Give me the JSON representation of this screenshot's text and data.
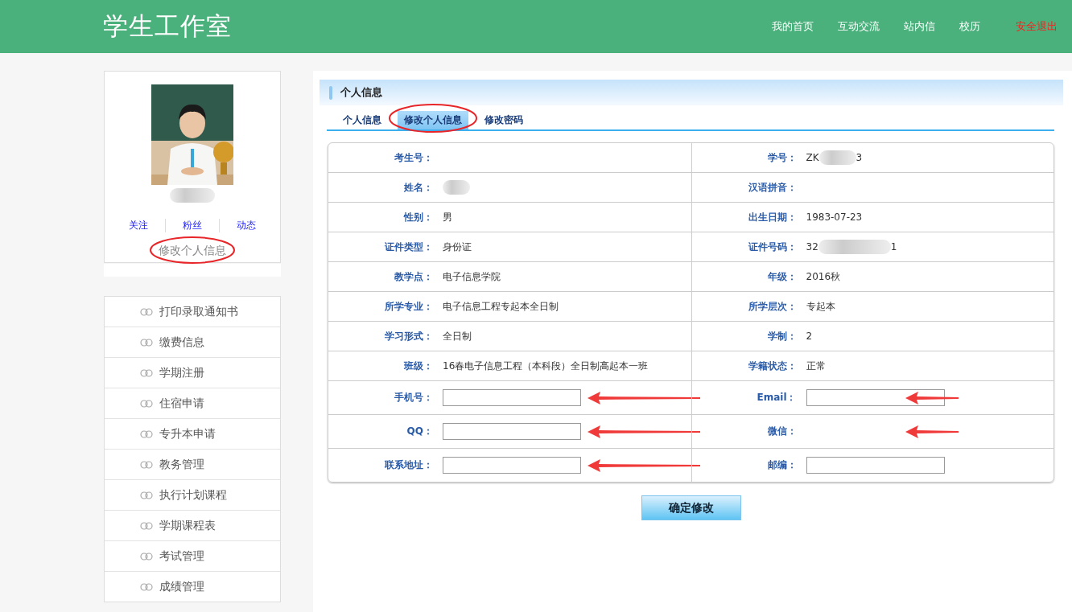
{
  "header": {
    "title": "学生工作室",
    "nav": [
      {
        "label": "我的首页",
        "kind": "link"
      },
      {
        "label": "互动交流",
        "kind": "link"
      },
      {
        "label": "站内信",
        "kind": "link"
      },
      {
        "label": "校历",
        "kind": "link"
      },
      {
        "label": "安全退出",
        "kind": "logout"
      }
    ]
  },
  "profile": {
    "name_redacted": true,
    "links": [
      "关注",
      "粉丝",
      "动态"
    ],
    "edit_link": {
      "label": "修改个人信息",
      "circled": true
    }
  },
  "menu": [
    "打印录取通知书",
    "缴费信息",
    "学期注册",
    "住宿申请",
    "专升本申请",
    "教务管理",
    "执行计划课程",
    "学期课程表",
    "考试管理",
    "成绩管理"
  ],
  "panel": {
    "title": "个人信息",
    "tabs": [
      {
        "label": "个人信息",
        "selected": false,
        "circled": false
      },
      {
        "label": "修改个人信息",
        "selected": true,
        "circled": true
      },
      {
        "label": "修改密码",
        "selected": false,
        "circled": false
      }
    ]
  },
  "form": {
    "rows": [
      [
        {
          "label": "考生号："
        },
        {
          "label": "学号：",
          "value": "ZK",
          "value_end": "3",
          "redacted": true
        }
      ],
      [
        {
          "label": "姓名：",
          "redacted": true
        },
        {
          "label": "汉语拼音："
        }
      ],
      [
        {
          "label": "性别：",
          "value": "男"
        },
        {
          "label": "出生日期：",
          "value": "1983-07-23"
        }
      ],
      [
        {
          "label": "证件类型：",
          "value": "身份证"
        },
        {
          "label": "证件号码：",
          "value": "32",
          "value_end": "1",
          "redacted": true
        }
      ],
      [
        {
          "label": "教学点：",
          "value": "电子信息学院"
        },
        {
          "label": "年级：",
          "value": "2016秋"
        }
      ],
      [
        {
          "label": "所学专业：",
          "value": "电子信息工程专起本全日制"
        },
        {
          "label": "所学层次：",
          "value": "专起本"
        }
      ],
      [
        {
          "label": "学习形式：",
          "value": "全日制"
        },
        {
          "label": "学制：",
          "value": "2"
        }
      ],
      [
        {
          "label": "班级：",
          "value": "16春电子信息工程（本科段）全日制高起本一班"
        },
        {
          "label": "学籍状态：",
          "value": "正常"
        }
      ],
      [
        {
          "label": "手机号：",
          "kind": "input",
          "arrow": true
        },
        {
          "label": "Email：",
          "kind": "input",
          "arrow": true
        }
      ],
      [
        {
          "label": "QQ：",
          "kind": "input",
          "arrow": true
        },
        {
          "label": "微信：",
          "arrow": true
        }
      ],
      [
        {
          "label": "联系地址：",
          "kind": "input",
          "arrow": true
        },
        {
          "label": "邮编：",
          "kind": "input"
        }
      ]
    ]
  },
  "submit": "确定修改"
}
